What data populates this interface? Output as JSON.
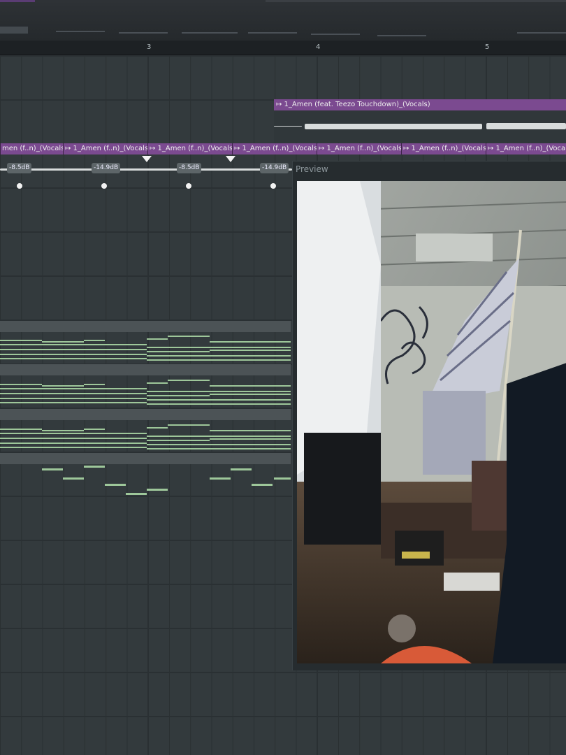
{
  "ruler": {
    "marks": [
      "3",
      "4",
      "5"
    ]
  },
  "playlist": {
    "top_clip_label": "↦ 1_Amen (feat. Teezo Touchdown)_(Vocals)",
    "row_clips": [
      "men (f..n)_(Vocals)",
      "↦ 1_Amen (f..n)_(Vocals)",
      "↦ 1_Amen (f..n)_(Vocals)",
      "↦ 1_Amen (f..n)_(Vocals)",
      "↦ 1_Amen (f..n)_(Vocals)",
      "↦ 1_Amen (f..n)_(Vocals)",
      "↦ 1_Amen (f..n)_(Vocals)"
    ],
    "volume_tags": [
      "-8.5dB",
      "-14.9dB",
      "-8.5dB",
      "-14.9dB"
    ]
  },
  "preview": {
    "title": "Preview"
  },
  "colors": {
    "clip_purple": "#7b4a90",
    "note_green": "#9ec79a",
    "background": "#2a3033"
  }
}
